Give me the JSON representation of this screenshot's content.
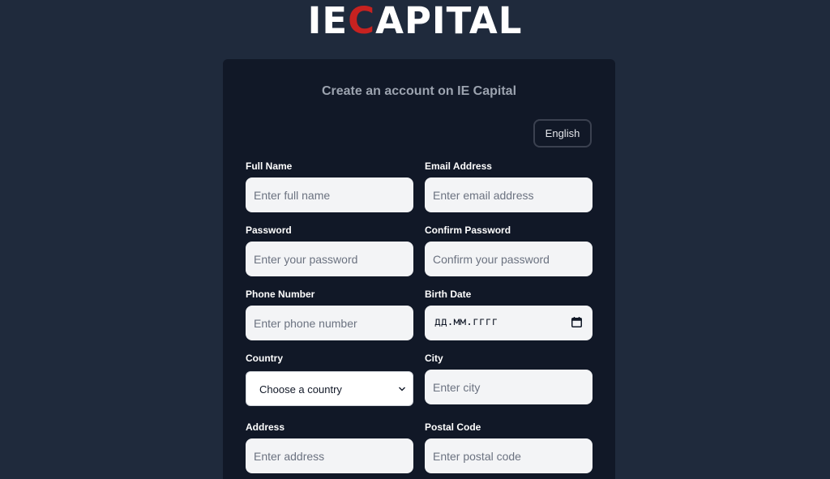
{
  "brand": {
    "logo_prefix": "IE",
    "logo_accent": "C",
    "logo_suffix": "APITAL",
    "accent_color": "#c72220"
  },
  "form": {
    "title": "Create an account on IE Capital",
    "language_button": "English",
    "fields": {
      "full_name": {
        "label": "Full Name",
        "placeholder": "Enter full name"
      },
      "email": {
        "label": "Email Address",
        "placeholder": "Enter email address"
      },
      "password": {
        "label": "Password",
        "placeholder": "Enter your password"
      },
      "confirm_password": {
        "label": "Confirm Password",
        "placeholder": "Confirm your password"
      },
      "phone": {
        "label": "Phone Number",
        "placeholder": "Enter phone number"
      },
      "birth_date": {
        "label": "Birth Date",
        "placeholder": "дд.мм.гггг"
      },
      "country": {
        "label": "Country",
        "selected": "Choose a country"
      },
      "city": {
        "label": "City",
        "placeholder": "Enter city"
      },
      "address": {
        "label": "Address",
        "placeholder": "Enter address"
      },
      "postal_code": {
        "label": "Postal Code",
        "placeholder": "Enter postal code"
      }
    }
  },
  "icons": {
    "calendar": "calendar-icon",
    "select_arrow": "chevron-down-icon"
  },
  "colors": {
    "page_background": "#1f2a3c",
    "card_background": "#111827",
    "input_background": "#f3f4f6"
  }
}
